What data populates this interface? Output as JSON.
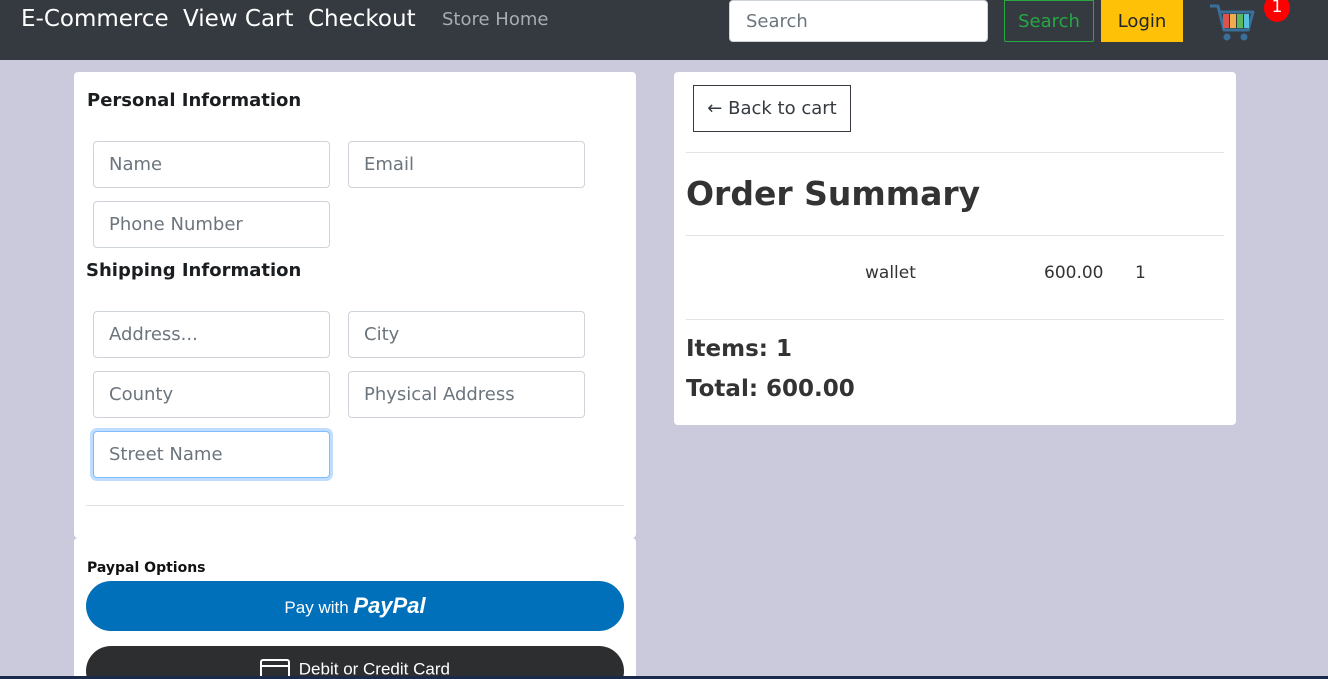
{
  "nav": {
    "brand": "E-Commerce",
    "view_cart": "View Cart",
    "checkout": "Checkout",
    "store_home": "Store Home",
    "search_placeholder": "Search",
    "search_button": "Search",
    "login_button": "Login",
    "cart_count": "1"
  },
  "form": {
    "personal_title": "Personal Information",
    "name_placeholder": "Name",
    "email_placeholder": "Email",
    "phone_placeholder": "Phone Number",
    "shipping_title": "Shipping Information",
    "address_placeholder": "Address...",
    "city_placeholder": "City",
    "county_placeholder": "County",
    "physical_placeholder": "Physical Address",
    "street_placeholder": "Street Name"
  },
  "payment": {
    "title": "Paypal Options",
    "paypal_prefix": "Pay with",
    "paypal_brand": "PayPal",
    "card_label": "Debit or Credit Card"
  },
  "summary": {
    "back_label": "← Back to cart",
    "title": "Order Summary",
    "items": [
      {
        "name": "wallet",
        "price": "600.00",
        "qty": "1"
      }
    ],
    "items_text": "Items: 1",
    "total_text": "Total: 600.00"
  },
  "colors": {
    "page_bg": "#cbcadd",
    "navbar_bg": "#343a40",
    "success": "#28a745",
    "warning": "#ffc107",
    "paypal_blue": "#0070ba",
    "badge_red": "#ff0000"
  }
}
